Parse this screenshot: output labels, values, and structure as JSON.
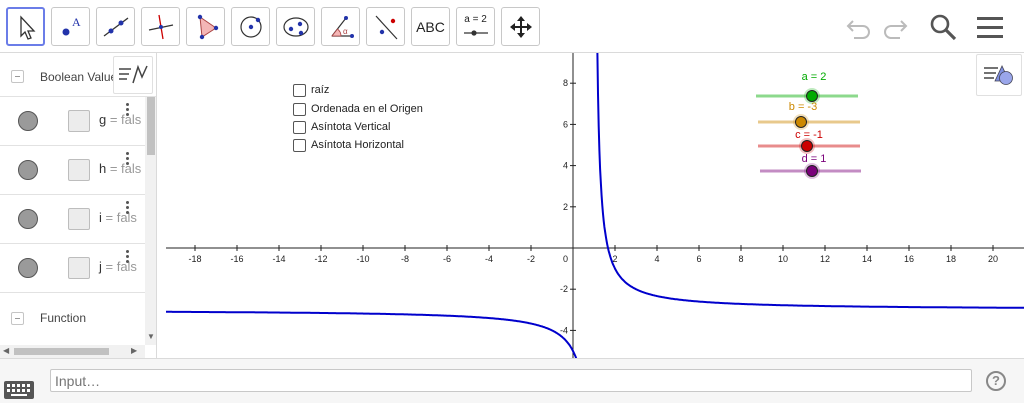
{
  "toolbar": {
    "tools": [
      {
        "name": "move-tool"
      },
      {
        "name": "point-tool",
        "label": "A"
      },
      {
        "name": "line-tool"
      },
      {
        "name": "perpendicular-line-tool"
      },
      {
        "name": "polygon-tool"
      },
      {
        "name": "circle-center-point-tool"
      },
      {
        "name": "ellipse-tool"
      },
      {
        "name": "angle-tool",
        "label": "α"
      },
      {
        "name": "reflect-tool"
      },
      {
        "name": "text-tool",
        "label": "ABC"
      },
      {
        "name": "slider-tool",
        "label": "a = 2"
      },
      {
        "name": "move-graphics-view-tool"
      }
    ]
  },
  "algebra": {
    "group1_label": "Boolean Value",
    "rows": [
      {
        "var": "g",
        "rest": " = fals"
      },
      {
        "var": "h",
        "rest": " = fals"
      },
      {
        "var": "i",
        "rest": " = fals"
      },
      {
        "var": "j",
        "rest": " = fals"
      }
    ],
    "group2_label": "Function"
  },
  "checkboxes": [
    {
      "label": "raíz"
    },
    {
      "label": "Ordenada en el Origen"
    },
    {
      "label": "Asíntota Vertical"
    },
    {
      "label": "Asíntota Horizontal"
    }
  ],
  "sliders": [
    {
      "label": "a = 2",
      "color": "#00aa00",
      "value": 2
    },
    {
      "label": "b = -3",
      "color": "#cc8800",
      "value": -3
    },
    {
      "label": "c = -1",
      "color": "#cc0000",
      "value": -1
    },
    {
      "label": "d = 1",
      "color": "#7a007a",
      "value": 1
    }
  ],
  "axes": {
    "x_ticks": [
      "-18",
      "-16",
      "-14",
      "-12",
      "-10",
      "-8",
      "-6",
      "-4",
      "-2",
      "2",
      "4",
      "6",
      "8",
      "10",
      "12",
      "14",
      "16",
      "18",
      "20"
    ],
    "y_ticks": [
      "8",
      "6",
      "4",
      "2",
      "-2",
      "-4"
    ],
    "origin_label": "0"
  },
  "function": {
    "color": "#0000cc"
  },
  "input": {
    "placeholder": "Input…"
  },
  "colors": {
    "accent": "#6b7de8",
    "curve": "#0000cc"
  }
}
